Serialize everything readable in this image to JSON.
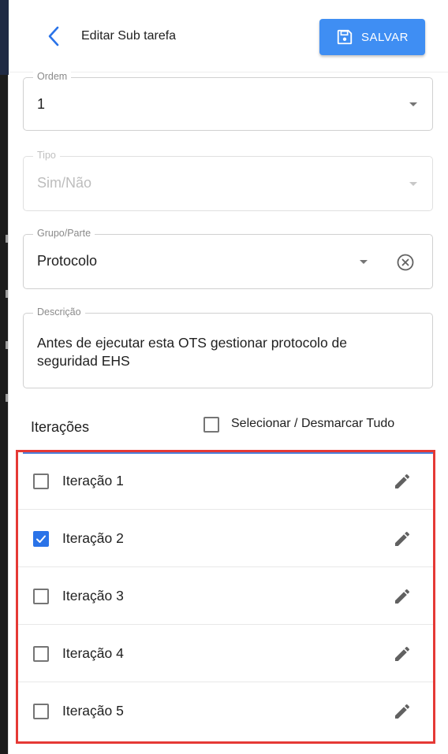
{
  "header": {
    "title": "Editar Sub tarefa",
    "save_label": "SALVAR",
    "accent_color": "#3f8ef3"
  },
  "fields": {
    "ordem": {
      "label": "Ordem",
      "value": "1"
    },
    "tipo": {
      "label": "Tipo",
      "value": "Sim/Não",
      "disabled": true
    },
    "grupo": {
      "label": "Grupo/Parte",
      "value": "Protocolo"
    },
    "descricao": {
      "label": "Descrição",
      "value": "Antes de ejecutar esta OTS gestionar protocolo de seguridad EHS"
    }
  },
  "iterations": {
    "title": "Iterações",
    "select_all_label": "Selecionar / Desmarcar Tudo",
    "select_all_checked": false,
    "items": [
      {
        "label": "Iteração 1",
        "checked": false
      },
      {
        "label": "Iteração 2",
        "checked": true
      },
      {
        "label": "Iteração 3",
        "checked": false
      },
      {
        "label": "Iteração 4",
        "checked": false
      },
      {
        "label": "Iteração 5",
        "checked": false
      }
    ]
  },
  "icons": {
    "back": "chevron-left-icon",
    "save": "floppy-disk-icon",
    "dropdown": "caret-down-icon",
    "clear": "clear-circle-icon",
    "edit": "pencil-icon",
    "check": "checkmark-icon"
  },
  "colors": {
    "checkbox_checked": "#2a73e8",
    "highlight_border": "#e53935"
  }
}
